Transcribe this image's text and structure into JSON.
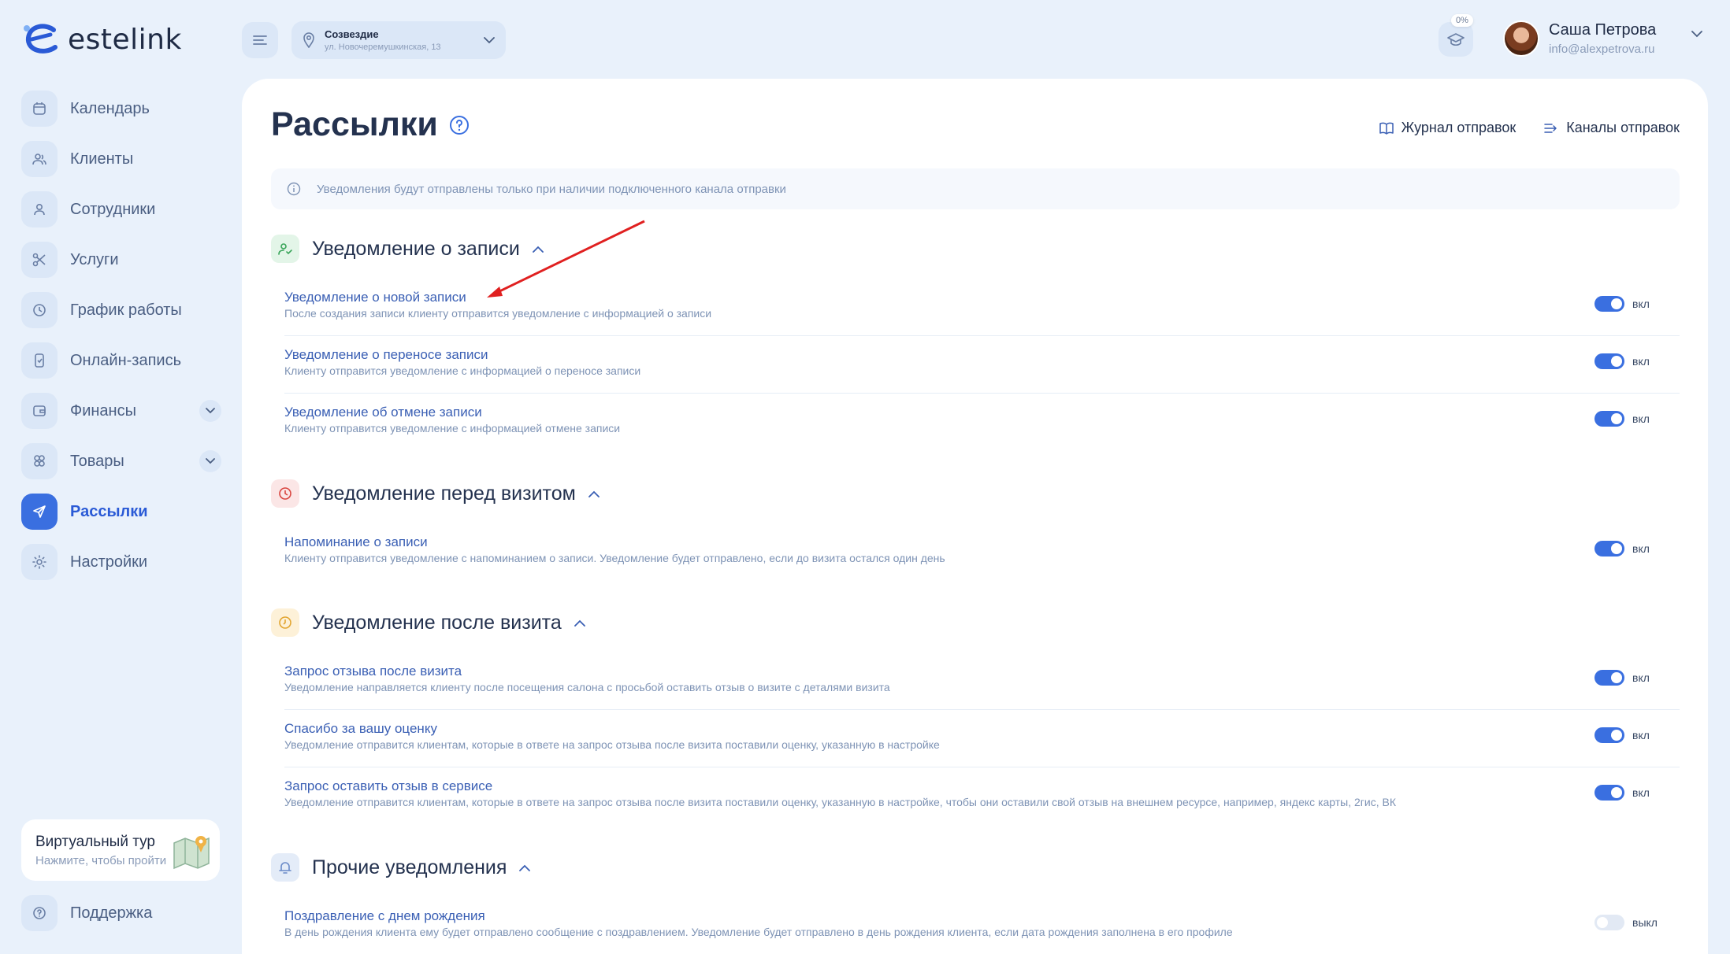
{
  "brand": {
    "name": "estelink"
  },
  "location": {
    "name": "Созвездие",
    "address": "ул. Новочеремушкинская, 13"
  },
  "progress": {
    "label": "0%",
    "value": 0
  },
  "user": {
    "name": "Саша Петрова",
    "email": "info@alexpetrova.ru"
  },
  "sidebar": {
    "items": [
      {
        "label": "Календарь",
        "icon": "calendar-icon"
      },
      {
        "label": "Клиенты",
        "icon": "clients-icon"
      },
      {
        "label": "Сотрудники",
        "icon": "user-icon"
      },
      {
        "label": "Услуги",
        "icon": "scissors-icon"
      },
      {
        "label": "График работы",
        "icon": "clock-icon"
      },
      {
        "label": "Онлайн-запись",
        "icon": "phone-icon"
      },
      {
        "label": "Финансы",
        "icon": "wallet-icon"
      },
      {
        "label": "Товары",
        "icon": "products-icon"
      },
      {
        "label": "Рассылки",
        "icon": "send-icon",
        "active": true
      },
      {
        "label": "Настройки",
        "icon": "gear-icon"
      }
    ],
    "tour": {
      "title": "Виртуальный тур",
      "subtitle": "Нажмите, чтобы пройти"
    },
    "support": {
      "label": "Поддержка"
    }
  },
  "page": {
    "title": "Рассылки",
    "links": {
      "log": "Журнал отправок",
      "channels": "Каналы отправок"
    },
    "banner": "Уведомления будут отправлены только при наличии подключенного канала отправки"
  },
  "sections": [
    {
      "title": "Уведомление о записи",
      "rows": [
        {
          "title": "Уведомление о новой записи",
          "desc": "После создания записи клиенту отправится уведомление с информацией о записи",
          "state": "вкл"
        },
        {
          "title": "Уведомление о переносе записи",
          "desc": "Клиенту отправится уведомление с информацией о переносе записи",
          "state": "вкл"
        },
        {
          "title": "Уведомление об отмене записи",
          "desc": "Клиенту отправится уведомление с информацией отмене записи",
          "state": "вкл"
        }
      ]
    },
    {
      "title": "Уведомление перед визитом",
      "rows": [
        {
          "title": "Напоминание о записи",
          "desc": "Клиенту отправится уведомление с напоминанием о записи. Уведомление будет отправлено, если до визита остался один день",
          "state": "вкл"
        }
      ]
    },
    {
      "title": "Уведомление после визита",
      "rows": [
        {
          "title": "Запрос отзыва после визита",
          "desc": "Уведомление направляется клиенту после посещения салона с просьбой оставить отзыв о визите с деталями визита",
          "state": "вкл"
        },
        {
          "title": "Спасибо за вашу оценку",
          "desc": "Уведомление отправится клиентам, которые в ответе на запрос отзыва после визита поставили оценку, указанную в настройке",
          "state": "вкл"
        },
        {
          "title": "Запрос оставить отзыв в сервисе",
          "desc": "Уведомление отправится клиентам, которые в ответе на запрос отзыва после визита поставили оценку, указанную в настройке, чтобы они оставили свой отзыв на внешнем ресурсе, например, яндекс карты, 2гис, ВК",
          "state": "вкл"
        }
      ]
    },
    {
      "title": "Прочие уведомления",
      "rows": [
        {
          "title": "Поздравление с днем рождения",
          "desc": "В день рождения клиента ему будет отправлено сообщение с поздравлением. Уведомление будет отправлено в день рождения клиента, если дата рождения заполнена в его профиле",
          "state": "выкл"
        }
      ]
    }
  ],
  "colors": {
    "accent": "#3a6fe0",
    "background": "#e9f1fb",
    "annotation_arrow": "#e02020"
  }
}
